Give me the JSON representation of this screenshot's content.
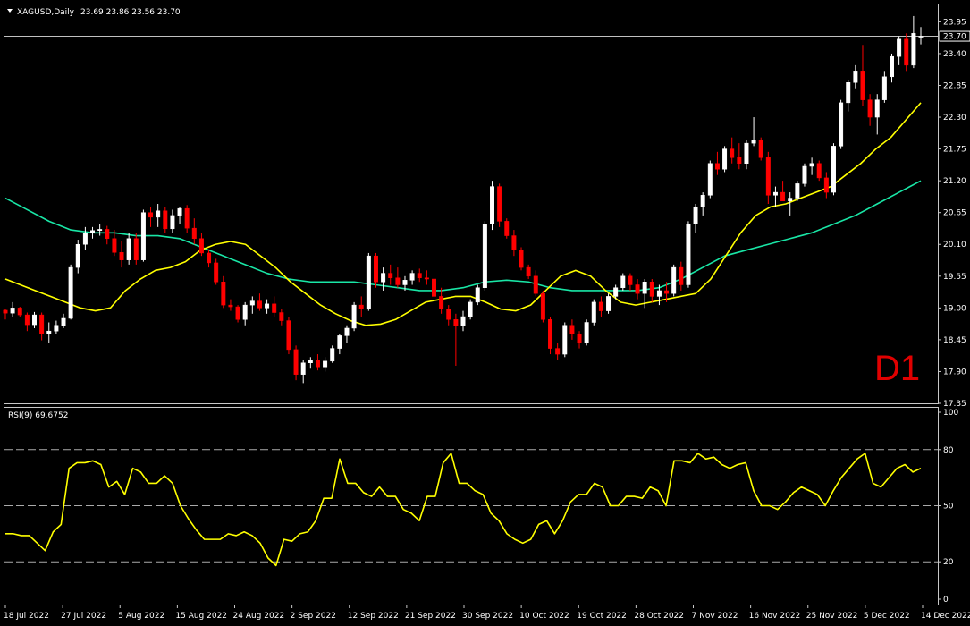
{
  "header": {
    "symbol_label": "XAGUSD,Daily",
    "ohlc_label": "23.69 23.86 23.56 23.70"
  },
  "timeframe_label": "D1",
  "current_price_label": "23.70",
  "colors": {
    "bull_candle": "#ffffff",
    "bear_candle": "#ff0000",
    "ma_fast": "#ffff00",
    "ma_slow": "#19e6a6",
    "rsi_line": "#ffff00",
    "frame": "#c8c8c8",
    "price_line": "#c0c0c0"
  },
  "icons": {
    "dropdown": "triangle-down-icon"
  },
  "chart_data": [
    {
      "type": "candlestick",
      "title": "XAGUSD,Daily",
      "ylim": [
        17.35,
        24.25
      ],
      "y_ticks": [
        "23.95",
        "23.40",
        "22.85",
        "22.30",
        "21.75",
        "21.20",
        "20.65",
        "20.10",
        "19.55",
        "19.00",
        "18.45",
        "17.90",
        "17.35"
      ],
      "x_ticks": [
        "18 Jul 2022",
        "27 Jul 2022",
        "5 Aug 2022",
        "15 Aug 2022",
        "24 Aug 2022",
        "2 Sep 2022",
        "12 Sep 2022",
        "21 Sep 2022",
        "30 Sep 2022",
        "10 Oct 2022",
        "19 Oct 2022",
        "28 Oct 2022",
        "7 Nov 2022",
        "16 Nov 2022",
        "25 Nov 2022",
        "5 Dec 2022",
        "14 Dec 2022"
      ],
      "last_price": 23.7,
      "candles": [
        [
          18.96,
          18.98,
          18.8,
          18.91
        ],
        [
          18.91,
          19.1,
          18.85,
          19.0
        ],
        [
          19.0,
          19.02,
          18.84,
          18.88
        ],
        [
          18.88,
          18.92,
          18.6,
          18.71
        ],
        [
          18.71,
          18.93,
          18.65,
          18.88
        ],
        [
          18.88,
          18.92,
          18.44,
          18.55
        ],
        [
          18.55,
          18.75,
          18.4,
          18.6
        ],
        [
          18.6,
          18.78,
          18.55,
          18.7
        ],
        [
          18.7,
          18.9,
          18.65,
          18.82
        ],
        [
          18.82,
          19.75,
          18.8,
          19.7
        ],
        [
          19.7,
          20.18,
          19.6,
          20.1
        ],
        [
          20.1,
          20.4,
          20.0,
          20.3
        ],
        [
          20.3,
          20.4,
          20.2,
          20.34
        ],
        [
          20.34,
          20.45,
          20.25,
          20.36
        ],
        [
          20.36,
          20.42,
          20.1,
          20.2
        ],
        [
          20.2,
          20.35,
          19.9,
          19.96
        ],
        [
          19.96,
          20.15,
          19.7,
          19.83
        ],
        [
          19.83,
          20.3,
          19.75,
          20.2
        ],
        [
          20.2,
          20.3,
          19.75,
          19.83
        ],
        [
          19.83,
          20.7,
          19.8,
          20.65
        ],
        [
          20.65,
          20.75,
          20.4,
          20.57
        ],
        [
          20.57,
          20.8,
          20.4,
          20.68
        ],
        [
          20.68,
          20.75,
          20.3,
          20.37
        ],
        [
          20.37,
          20.7,
          20.3,
          20.6
        ],
        [
          20.6,
          20.75,
          20.45,
          20.72
        ],
        [
          20.72,
          20.78,
          20.3,
          20.38
        ],
        [
          20.38,
          20.55,
          20.1,
          20.2
        ],
        [
          20.2,
          20.3,
          19.9,
          19.95
        ],
        [
          19.95,
          20.0,
          19.7,
          19.78
        ],
        [
          19.78,
          19.85,
          19.4,
          19.45
        ],
        [
          19.45,
          19.55,
          19.0,
          19.05
        ],
        [
          19.05,
          19.15,
          18.95,
          19.02
        ],
        [
          19.02,
          19.05,
          18.75,
          18.8
        ],
        [
          18.8,
          19.1,
          18.7,
          19.05
        ],
        [
          19.05,
          19.2,
          18.9,
          19.12
        ],
        [
          19.12,
          19.25,
          18.95,
          19.0
        ],
        [
          19.0,
          19.15,
          18.9,
          19.07
        ],
        [
          19.07,
          19.2,
          18.85,
          18.92
        ],
        [
          18.92,
          18.98,
          18.7,
          18.78
        ],
        [
          18.78,
          18.85,
          18.2,
          18.28
        ],
        [
          18.28,
          18.35,
          17.75,
          17.85
        ],
        [
          17.85,
          18.1,
          17.7,
          18.05
        ],
        [
          18.05,
          18.15,
          17.95,
          18.1
        ],
        [
          18.1,
          18.2,
          17.92,
          17.98
        ],
        [
          17.98,
          18.15,
          17.9,
          18.08
        ],
        [
          18.08,
          18.35,
          18.05,
          18.3
        ],
        [
          18.3,
          18.55,
          18.2,
          18.52
        ],
        [
          18.52,
          18.7,
          18.4,
          18.65
        ],
        [
          18.65,
          19.1,
          18.6,
          19.05
        ],
        [
          19.05,
          19.2,
          18.85,
          18.98
        ],
        [
          18.98,
          19.95,
          18.95,
          19.9
        ],
        [
          19.9,
          19.95,
          19.35,
          19.45
        ],
        [
          19.45,
          19.7,
          19.3,
          19.6
        ],
        [
          19.6,
          19.75,
          19.4,
          19.52
        ],
        [
          19.52,
          19.7,
          19.35,
          19.4
        ],
        [
          19.4,
          19.55,
          19.3,
          19.48
        ],
        [
          19.48,
          19.65,
          19.4,
          19.6
        ],
        [
          19.6,
          19.68,
          19.45,
          19.52
        ],
        [
          19.52,
          19.65,
          19.4,
          19.5
        ],
        [
          19.5,
          19.55,
          19.1,
          19.2
        ],
        [
          19.2,
          19.35,
          18.9,
          18.98
        ],
        [
          18.98,
          19.05,
          18.7,
          18.8
        ],
        [
          18.8,
          18.9,
          18.0,
          18.7
        ],
        [
          18.7,
          18.95,
          18.6,
          18.85
        ],
        [
          18.85,
          19.15,
          18.8,
          19.1
        ],
        [
          19.1,
          19.4,
          19.05,
          19.35
        ],
        [
          19.35,
          20.5,
          19.3,
          20.45
        ],
        [
          20.45,
          21.2,
          20.35,
          21.1
        ],
        [
          21.1,
          21.15,
          20.4,
          20.5
        ],
        [
          20.5,
          20.55,
          20.2,
          20.25
        ],
        [
          20.25,
          20.35,
          19.9,
          20.0
        ],
        [
          20.0,
          20.05,
          19.65,
          19.7
        ],
        [
          19.7,
          19.75,
          19.5,
          19.55
        ],
        [
          19.55,
          19.65,
          19.2,
          19.25
        ],
        [
          19.25,
          19.3,
          18.75,
          18.8
        ],
        [
          18.8,
          18.85,
          18.2,
          18.3
        ],
        [
          18.3,
          18.4,
          18.1,
          18.2
        ],
        [
          18.2,
          18.75,
          18.15,
          18.7
        ],
        [
          18.7,
          18.8,
          18.45,
          18.55
        ],
        [
          18.55,
          18.6,
          18.3,
          18.4
        ],
        [
          18.4,
          18.8,
          18.35,
          18.75
        ],
        [
          18.75,
          19.15,
          18.7,
          19.1
        ],
        [
          19.1,
          19.2,
          18.85,
          18.95
        ],
        [
          18.95,
          19.25,
          18.9,
          19.2
        ],
        [
          19.2,
          19.4,
          19.15,
          19.35
        ],
        [
          19.35,
          19.6,
          19.3,
          19.55
        ],
        [
          19.55,
          19.6,
          19.3,
          19.4
        ],
        [
          19.4,
          19.5,
          19.15,
          19.25
        ],
        [
          19.25,
          19.5,
          19.0,
          19.45
        ],
        [
          19.45,
          19.5,
          19.1,
          19.2
        ],
        [
          19.2,
          19.4,
          19.05,
          19.3
        ],
        [
          19.3,
          19.45,
          19.1,
          19.25
        ],
        [
          19.25,
          19.75,
          19.2,
          19.7
        ],
        [
          19.7,
          19.8,
          19.3,
          19.4
        ],
        [
          19.4,
          20.5,
          19.35,
          20.45
        ],
        [
          20.45,
          20.8,
          20.3,
          20.75
        ],
        [
          20.75,
          21.0,
          20.6,
          20.95
        ],
        [
          20.95,
          21.55,
          20.9,
          21.5
        ],
        [
          21.5,
          21.7,
          21.3,
          21.4
        ],
        [
          21.4,
          21.8,
          21.35,
          21.75
        ],
        [
          21.75,
          21.95,
          21.5,
          21.6
        ],
        [
          21.6,
          21.85,
          21.4,
          21.5
        ],
        [
          21.5,
          21.9,
          21.4,
          21.85
        ],
        [
          21.85,
          22.3,
          21.8,
          21.9
        ],
        [
          21.9,
          21.95,
          21.55,
          21.6
        ],
        [
          21.6,
          21.7,
          20.8,
          20.95
        ],
        [
          20.95,
          21.1,
          20.75,
          21.0
        ],
        [
          21.0,
          21.2,
          20.85,
          20.85
        ],
        [
          20.85,
          21.0,
          20.6,
          20.9
        ],
        [
          20.9,
          21.2,
          20.85,
          21.15
        ],
        [
          21.15,
          21.5,
          21.1,
          21.45
        ],
        [
          21.45,
          21.6,
          21.3,
          21.5
        ],
        [
          21.5,
          21.55,
          21.2,
          21.25
        ],
        [
          21.25,
          21.35,
          20.9,
          21.0
        ],
        [
          21.0,
          21.85,
          20.95,
          21.8
        ],
        [
          21.8,
          22.6,
          21.75,
          22.55
        ],
        [
          22.55,
          22.95,
          22.4,
          22.9
        ],
        [
          22.9,
          23.2,
          22.8,
          23.1
        ],
        [
          23.1,
          23.55,
          22.5,
          22.6
        ],
        [
          22.6,
          22.7,
          22.15,
          22.3
        ],
        [
          22.3,
          22.7,
          22.0,
          22.6
        ],
        [
          22.6,
          23.1,
          22.55,
          23.0
        ],
        [
          23.0,
          23.4,
          22.9,
          23.35
        ],
        [
          23.35,
          23.7,
          23.2,
          23.65
        ],
        [
          23.65,
          23.75,
          23.1,
          23.2
        ],
        [
          23.2,
          24.05,
          23.15,
          23.75
        ],
        [
          23.69,
          23.86,
          23.56,
          23.7
        ]
      ],
      "ma_fast": [
        19.5,
        19.4,
        19.3,
        19.2,
        19.1,
        19.0,
        18.95,
        19.0,
        19.3,
        19.5,
        19.65,
        19.7,
        19.8,
        20.0,
        20.1,
        20.15,
        20.1,
        19.9,
        19.7,
        19.45,
        19.25,
        19.05,
        18.9,
        18.78,
        18.7,
        18.72,
        18.8,
        18.95,
        19.1,
        19.15,
        19.2,
        19.2,
        19.1,
        18.98,
        18.95,
        19.05,
        19.3,
        19.55,
        19.65,
        19.55,
        19.3,
        19.1,
        19.05,
        19.1,
        19.15,
        19.2,
        19.25,
        19.5,
        19.9,
        20.3,
        20.6,
        20.75,
        20.8,
        20.9,
        21.0,
        21.1,
        21.3,
        21.5,
        21.75,
        21.95,
        22.25,
        22.55
      ],
      "ma_slow": [
        20.9,
        20.7,
        20.5,
        20.35,
        20.3,
        20.3,
        20.25,
        20.25,
        20.2,
        20.05,
        19.9,
        19.75,
        19.6,
        19.5,
        19.45,
        19.45,
        19.45,
        19.4,
        19.35,
        19.3,
        19.3,
        19.35,
        19.45,
        19.48,
        19.45,
        19.35,
        19.3,
        19.3,
        19.3,
        19.3,
        19.35,
        19.5,
        19.7,
        19.9,
        20.0,
        20.1,
        20.2,
        20.3,
        20.45,
        20.6,
        20.8,
        21.0,
        21.2
      ],
      "series": [
        {
          "name": "",
          "color": "#ffff00"
        },
        {
          "name": "",
          "color": "#19e6a6"
        }
      ]
    },
    {
      "type": "line",
      "title": "RSI(9) 69.6752",
      "ylim": [
        0,
        100
      ],
      "y_ticks": [
        "100",
        "80",
        "50",
        "20",
        "0"
      ],
      "levels": [
        80,
        50,
        20
      ],
      "values": [
        35,
        35,
        34,
        34,
        30,
        26,
        36,
        40,
        70,
        73,
        73,
        74,
        72,
        60,
        63,
        56,
        70,
        68,
        62,
        62,
        66,
        62,
        50,
        43,
        37,
        32,
        32,
        32,
        35,
        34,
        36,
        34,
        30,
        22,
        18,
        32,
        31,
        35,
        36,
        42,
        54,
        54,
        75,
        62,
        62,
        57,
        55,
        60,
        55,
        55,
        48,
        46,
        42,
        55,
        55,
        73,
        78,
        62,
        62,
        58,
        56,
        46,
        42,
        35,
        32,
        30,
        32,
        40,
        42,
        35,
        42,
        52,
        56,
        56,
        62,
        60,
        50,
        50,
        55,
        55,
        54,
        60,
        58,
        50,
        74,
        74,
        73,
        78,
        75,
        76,
        72,
        70,
        72,
        73,
        58,
        50,
        50,
        48,
        52,
        57,
        60,
        58,
        56,
        50,
        58,
        65,
        70,
        75,
        78,
        62,
        60,
        65,
        70,
        72,
        68,
        70
      ],
      "last_value": 69.6752
    }
  ]
}
